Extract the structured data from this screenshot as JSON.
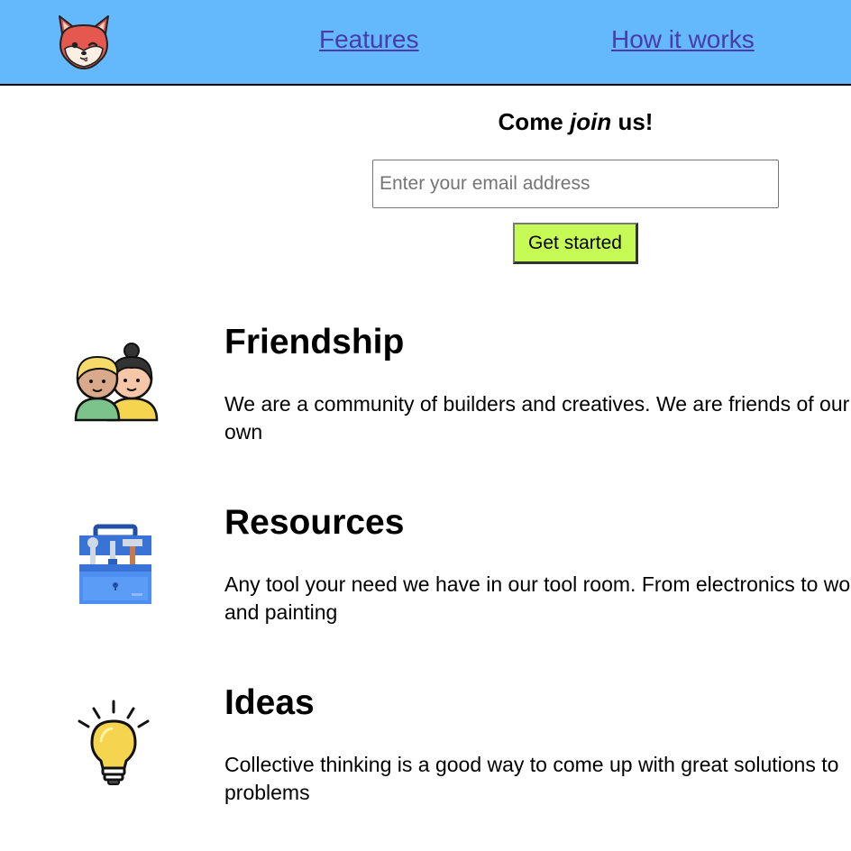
{
  "header": {
    "logo_icon": "fox-logo-icon",
    "nav": [
      {
        "label": "Features"
      },
      {
        "label": "How it works"
      }
    ],
    "background_color": "#63b9fb",
    "link_color": "#4a3ba8"
  },
  "signup": {
    "title_before": "Come ",
    "title_emphasis": "join",
    "title_after": " us!",
    "email_placeholder": "Enter your email address",
    "email_value": "",
    "button_label": "Get started",
    "button_color": "#c6fb55"
  },
  "features": [
    {
      "icon": "friends-icon",
      "title": "Friendship",
      "text": "We are a community of builders and creatives. We are friends of our own"
    },
    {
      "icon": "toolbox-icon",
      "title": "Resources",
      "text": "Any tool your need we have in our tool room. From electronics to wood and painting"
    },
    {
      "icon": "lightbulb-icon",
      "title": "Ideas",
      "text": "Collective thinking is a good way to come up with great solutions to problems"
    }
  ]
}
